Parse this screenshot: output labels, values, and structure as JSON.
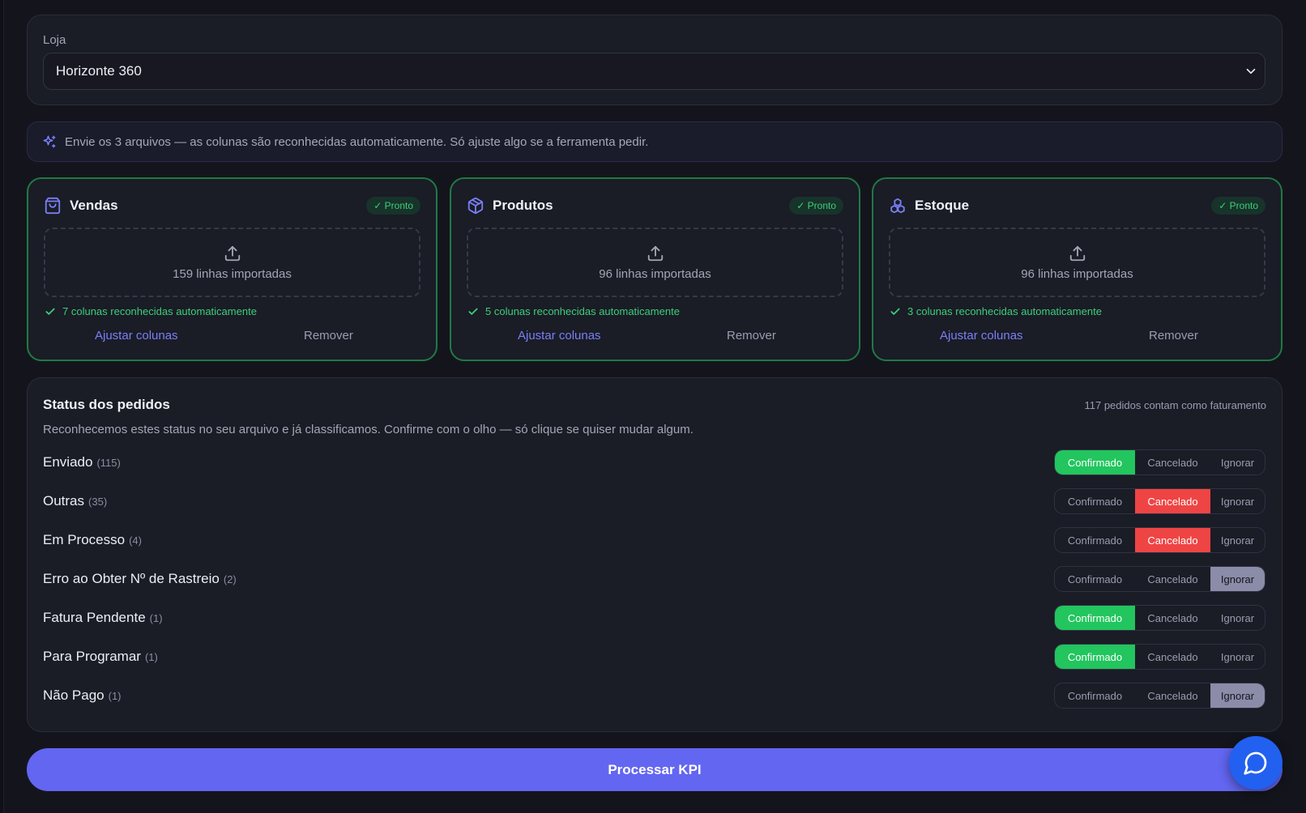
{
  "store": {
    "label": "Loja",
    "value": "Horizonte 360"
  },
  "banner": {
    "text": "Envie os 3 arquivos — as colunas são reconhecidas automaticamente. Só ajuste algo se a ferramenta pedir."
  },
  "cards": [
    {
      "title": "Vendas",
      "icon": "shopping-bag-icon",
      "badge": "✓ Pronto",
      "rows": "159 linhas importadas",
      "recognized": "7 colunas reconhecidas automaticamente",
      "adjust": "Ajustar colunas",
      "remove": "Remover"
    },
    {
      "title": "Produtos",
      "icon": "package-icon",
      "badge": "✓ Pronto",
      "rows": "96 linhas importadas",
      "recognized": "5 colunas reconhecidas automaticamente",
      "adjust": "Ajustar colunas",
      "remove": "Remover"
    },
    {
      "title": "Estoque",
      "icon": "boxes-icon",
      "badge": "✓ Pronto",
      "rows": "96 linhas importadas",
      "recognized": "3 colunas reconhecidas automaticamente",
      "adjust": "Ajustar colunas",
      "remove": "Remover"
    }
  ],
  "status": {
    "title": "Status dos pedidos",
    "count_text": "117 pedidos contam como faturamento",
    "description": "Reconhecemos estes status no seu arquivo e já classificamos. Confirme com o olho — só clique se quiser mudar algum.",
    "options": [
      "Confirmado",
      "Cancelado",
      "Ignorar"
    ],
    "rows": [
      {
        "name": "Enviado",
        "count": "(115)",
        "selected": "Confirmado"
      },
      {
        "name": "Outras",
        "count": "(35)",
        "selected": "Cancelado"
      },
      {
        "name": "Em Processo",
        "count": "(4)",
        "selected": "Cancelado"
      },
      {
        "name": "Erro ao Obter Nº de Rastreio",
        "count": "(2)",
        "selected": "Ignorar"
      },
      {
        "name": "Fatura Pendente",
        "count": "(1)",
        "selected": "Confirmado"
      },
      {
        "name": "Para Programar",
        "count": "(1)",
        "selected": "Confirmado"
      },
      {
        "name": "Não Pago",
        "count": "(1)",
        "selected": "Ignorar"
      }
    ]
  },
  "process_button": "Processar KPI",
  "colors": {
    "accent": "#6366f1",
    "success": "#22c55e",
    "danger": "#ef4444",
    "neutral": "#8b8ca8",
    "chat": "#2260f0"
  }
}
